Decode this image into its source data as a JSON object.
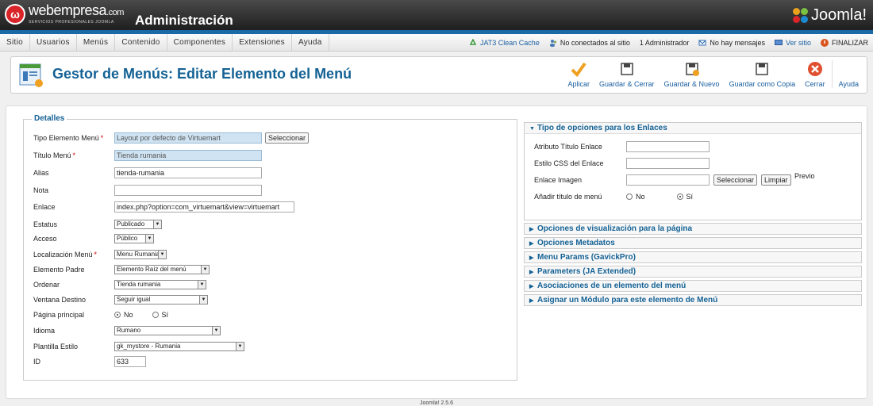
{
  "header": {
    "brand_name": "webempresa",
    "brand_suffix": ".com",
    "brand_tagline": "SERVICIOS PROFESIONALES JOOMLA",
    "admin_title": "Administración",
    "joomla_logo": "Joomla!"
  },
  "menubar": {
    "items": [
      "Sitio",
      "Usuarios",
      "Menús",
      "Contenido",
      "Componentes",
      "Extensiones",
      "Ayuda"
    ],
    "status": {
      "cache": "JAT3 Clean Cache",
      "visitors": "No conectados al sitio",
      "admins": "1 Administrador",
      "messages": "No hay mensajes",
      "view_site": "Ver sitio",
      "logout": "FINALIZAR"
    }
  },
  "toolbar": {
    "title": "Gestor de Menús: Editar Elemento del Menú",
    "buttons": {
      "apply": "Aplicar",
      "save_close": "Guardar & Cerrar",
      "save_new": "Guardar & Nuevo",
      "save_copy": "Guardar como Copia",
      "close": "Cerrar",
      "help": "Ayuda"
    }
  },
  "details": {
    "legend": "Detalles",
    "labels": {
      "menu_item_type": "Tipo Elemento Menú",
      "menu_title": "Título Menú",
      "alias": "Alias",
      "note": "Nota",
      "link": "Enlace",
      "status": "Estatus",
      "access": "Acceso",
      "menu_location": "Localización Menú",
      "parent": "Elemento Padre",
      "ordering": "Ordenar",
      "target": "Ventana Destino",
      "home": "Página principal",
      "language": "Idioma",
      "template_style": "Plantilla Estilo",
      "id": "ID"
    },
    "values": {
      "menu_item_type": "Layout por defecto de Virtuemart",
      "select_button": "Seleccionar",
      "menu_title": "Tienda rumania",
      "alias": "tienda-rumania",
      "note": "",
      "link": "index.php?option=com_virtuemart&view=virtuemart",
      "status": "Publicado",
      "access": "Público",
      "menu_location": "Menu Rumania",
      "parent": "Elemento Raíz del menú",
      "ordering": "Tienda rumania",
      "target": "Seguir igual",
      "home_no": "No",
      "home_yes": "Sí",
      "language": "Rumano",
      "template_style": "gk_mystore - Rumania",
      "id": "633"
    }
  },
  "link_options": {
    "title": "Tipo de opciones para los Enlaces",
    "labels": {
      "title_attr": "Atributo Título Enlace",
      "css_style": "Estilo CSS del Enlace",
      "image": "Enlace Imagen",
      "add_title": "Añadir título de menú"
    },
    "select_button": "Seleccionar",
    "clear_button": "Limpiar",
    "preview": "Previo",
    "radio_no": "No",
    "radio_yes": "Sí"
  },
  "panels": [
    "Opciones de visualización para la página",
    "Opciones Metadatos",
    "Menu Params (GavickPro)",
    "Parameters (JA Extended)",
    "Asociaciones de un elemento del menú",
    "Asignar un Módulo para este elemento de Menú"
  ],
  "footer": "Joomla! 2.5.6"
}
